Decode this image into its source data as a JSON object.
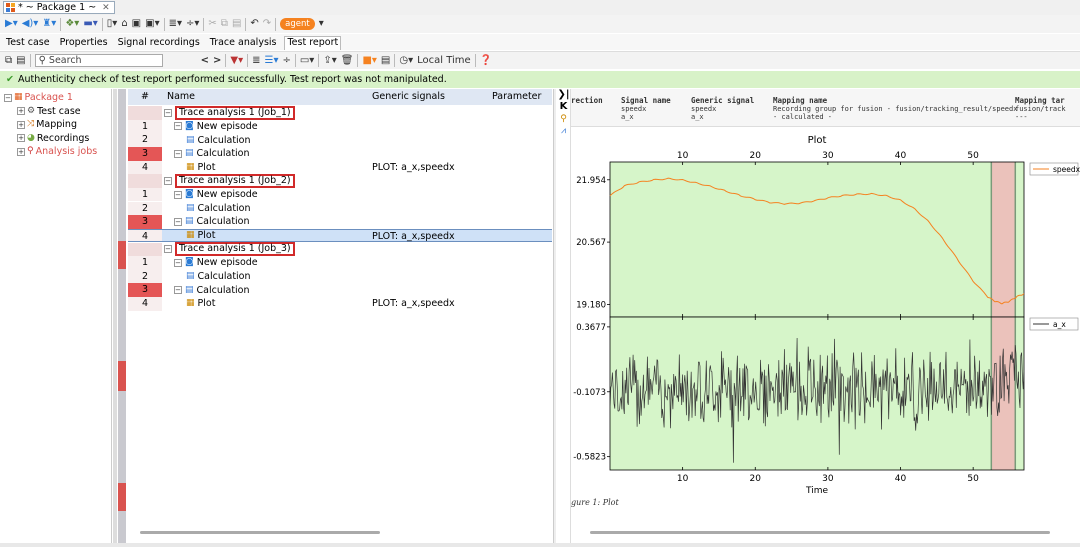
{
  "window": {
    "tab_title": "* ~ Package 1 ~"
  },
  "toolbar1": {
    "agent_label": "agent"
  },
  "menu": [
    "Test case",
    "Properties",
    "Signal recordings",
    "Trace analysis",
    "Test report"
  ],
  "toolbar2": {
    "search_placeholder": "Search",
    "time_label": "Local Time"
  },
  "status": {
    "message": "Authenticity check of test report performed successfully. Test report was not manipulated."
  },
  "tree": [
    {
      "label": "Package 1",
      "level": 0,
      "color": "#d9534f",
      "icon": "package-icon"
    },
    {
      "label": "Test case",
      "level": 1,
      "color": "#000",
      "icon": "test-case-icon"
    },
    {
      "label": "Mapping",
      "level": 1,
      "color": "#000",
      "icon": "mapping-icon"
    },
    {
      "label": "Recordings",
      "level": 1,
      "color": "#000",
      "icon": "recordings-icon"
    },
    {
      "label": "Analysis jobs",
      "level": 1,
      "color": "#d9534f",
      "icon": "analysis-jobs-icon"
    }
  ],
  "table": {
    "headers": {
      "num": "#",
      "name": "Name",
      "generic": "Generic signals",
      "param": "Parameter"
    },
    "rows": [
      {
        "n": "",
        "name": "Trace analysis 1 (Job_1)",
        "indent": 0,
        "kind": "job",
        "generic": "",
        "mark": "h"
      },
      {
        "n": "1",
        "name": "New episode",
        "indent": 1,
        "kind": "episode",
        "generic": "",
        "mark": "p"
      },
      {
        "n": "2",
        "name": "Calculation",
        "indent": 2,
        "kind": "calc",
        "generic": "",
        "mark": "p"
      },
      {
        "n": "3",
        "name": "Calculation",
        "indent": 1,
        "kind": "calc",
        "generic": "",
        "mark": "r"
      },
      {
        "n": "4",
        "name": "Plot",
        "indent": 2,
        "kind": "plot",
        "generic": "PLOT: a_x,speedx",
        "mark": "p"
      },
      {
        "n": "",
        "name": "Trace analysis 1 (Job_2)",
        "indent": 0,
        "kind": "job",
        "generic": "",
        "mark": "h"
      },
      {
        "n": "1",
        "name": "New episode",
        "indent": 1,
        "kind": "episode",
        "generic": "",
        "mark": "p"
      },
      {
        "n": "2",
        "name": "Calculation",
        "indent": 2,
        "kind": "calc",
        "generic": "",
        "mark": "p"
      },
      {
        "n": "3",
        "name": "Calculation",
        "indent": 1,
        "kind": "calc",
        "generic": "",
        "mark": "r"
      },
      {
        "n": "4",
        "name": "Plot",
        "indent": 2,
        "kind": "plot",
        "generic": "PLOT: a_x,speedx",
        "mark": "p",
        "selected": true
      },
      {
        "n": "",
        "name": "Trace analysis 1 (Job_3)",
        "indent": 0,
        "kind": "job",
        "generic": "",
        "mark": "h"
      },
      {
        "n": "1",
        "name": "New episode",
        "indent": 1,
        "kind": "episode",
        "generic": "",
        "mark": "p"
      },
      {
        "n": "2",
        "name": "Calculation",
        "indent": 2,
        "kind": "calc",
        "generic": "",
        "mark": "p"
      },
      {
        "n": "3",
        "name": "Calculation",
        "indent": 1,
        "kind": "calc",
        "generic": "",
        "mark": "r"
      },
      {
        "n": "4",
        "name": "Plot",
        "indent": 2,
        "kind": "plot",
        "generic": "PLOT: a_x,speedx",
        "mark": "p"
      }
    ]
  },
  "mapping": {
    "direction": "rection",
    "signal_name": {
      "title": "Signal name",
      "lines": [
        "speedx",
        "a_x"
      ]
    },
    "generic_signal": {
      "title": "Generic signal",
      "lines": [
        "speedx",
        "a_x"
      ]
    },
    "mapping_name": {
      "title": "Mapping name",
      "lines": [
        "Recording group for fusion - fusion/tracking_result/speedx",
        "- calculated -"
      ]
    },
    "mapping_target": {
      "title": "Mapping tar",
      "lines": [
        "fusion/track",
        "---"
      ]
    }
  },
  "figure_caption": "gure 1:  Plot",
  "chart_data": [
    {
      "type": "line",
      "title": "Plot",
      "xlabel": "",
      "ylabel": "",
      "xticks": [
        10,
        20,
        30,
        40,
        50
      ],
      "xlim": [
        0,
        57
      ],
      "ylim": [
        18.9,
        22.35
      ],
      "yticks": [
        "21.954",
        "20.567",
        "19.180"
      ],
      "ytick_values": [
        21.954,
        20.567,
        19.18
      ],
      "legend": "top-right",
      "series": [
        {
          "name": "speedx",
          "color": "#f58220",
          "x": [
            0,
            2,
            4,
            6,
            8,
            10,
            12,
            14,
            16,
            18,
            20,
            22,
            24,
            26,
            28,
            30,
            32,
            34,
            36,
            38,
            40,
            42,
            44,
            46,
            48,
            50,
            52,
            53,
            54,
            55,
            56,
            57
          ],
          "y": [
            21.6,
            21.82,
            21.9,
            21.95,
            21.98,
            21.95,
            21.88,
            21.8,
            21.7,
            21.6,
            21.52,
            21.45,
            21.42,
            21.43,
            21.48,
            21.55,
            21.6,
            21.63,
            21.64,
            21.6,
            21.5,
            21.3,
            21.0,
            20.6,
            20.15,
            19.7,
            19.35,
            19.25,
            19.2,
            19.25,
            19.35,
            19.42
          ]
        }
      ],
      "highlight_x": [
        52.5,
        55.8
      ],
      "green_region": [
        0,
        57
      ]
    },
    {
      "type": "line",
      "title": "",
      "xlabel": "Time",
      "ylabel": "",
      "xticks": [
        10,
        20,
        30,
        40,
        50
      ],
      "xlim": [
        0,
        57
      ],
      "ylim": [
        -0.68,
        0.44
      ],
      "yticks": [
        "0.3677",
        "-0.1073",
        "-0.5823"
      ],
      "ytick_values": [
        0.3677,
        -0.1073,
        -0.5823
      ],
      "legend": "top-right",
      "series": [
        {
          "name": "a_x",
          "color": "#333333",
          "noise_center": -0.08,
          "noise_amplitude": 0.22
        }
      ],
      "highlight_x": [
        52.5,
        55.8
      ],
      "green_region": [
        0,
        57
      ]
    }
  ]
}
